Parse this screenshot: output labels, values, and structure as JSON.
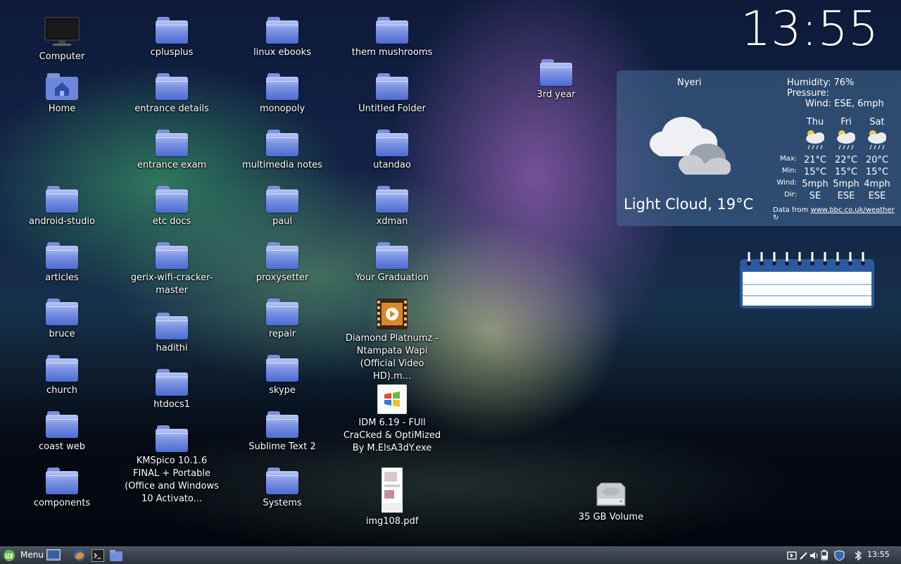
{
  "desktop_icons": [
    {
      "label": "Computer",
      "type": "computer"
    },
    {
      "label": "cplusplus",
      "type": "folder"
    },
    {
      "label": "linux ebooks",
      "type": "folder"
    },
    {
      "label": "them mushrooms",
      "type": "folder"
    },
    {
      "label": "Home",
      "type": "home"
    },
    {
      "label": "entrance details",
      "type": "folder"
    },
    {
      "label": "monopoly",
      "type": "folder"
    },
    {
      "label": "Untitled Folder",
      "type": "folder"
    },
    {
      "label": "3rd year",
      "type": "folder"
    },
    {
      "label": "entrance exam",
      "type": "folder"
    },
    {
      "label": "multimedia notes",
      "type": "folder"
    },
    {
      "label": "utandao",
      "type": "folder"
    },
    {
      "label": "android-studio",
      "type": "folder"
    },
    {
      "label": "etc docs",
      "type": "folder"
    },
    {
      "label": "paul",
      "type": "folder"
    },
    {
      "label": "xdman",
      "type": "folder"
    },
    {
      "label": "articles",
      "type": "folder"
    },
    {
      "label": "gerix-wifi-cracker-master",
      "type": "folder"
    },
    {
      "label": "proxysetter",
      "type": "folder"
    },
    {
      "label": "Your Graduation",
      "type": "folder"
    },
    {
      "label": "bruce",
      "type": "folder"
    },
    {
      "label": "repair",
      "type": "folder"
    },
    {
      "label": "Diamond Platnumz - Ntampata Wapi (Official Video HD).m...",
      "type": "video"
    },
    {
      "label": "hadithi",
      "type": "folder"
    },
    {
      "label": "church",
      "type": "folder"
    },
    {
      "label": "htdocs1",
      "type": "folder"
    },
    {
      "label": "skype",
      "type": "folder"
    },
    {
      "label": "IDM 6.19 - FUll CraCked & OptiMized By M.ElsA3dY.exe",
      "type": "exe"
    },
    {
      "label": "coast web",
      "type": "folder"
    },
    {
      "label": "KMSpico 10.1.6 FINAL + Portable (Office and Windows 10 Activato...",
      "type": "folder"
    },
    {
      "label": "Sublime Text 2",
      "type": "folder"
    },
    {
      "label": "components",
      "type": "folder"
    },
    {
      "label": "Systems",
      "type": "folder"
    },
    {
      "label": "img108.pdf",
      "type": "pdf"
    },
    {
      "label": "35 GB Volume",
      "type": "drive"
    }
  ],
  "clock": {
    "time": "13:55"
  },
  "weather": {
    "city": "Nyeri",
    "condition": "Light Cloud, 19°C",
    "humidity": "Humidity: 76%",
    "pressure": "Pressure:",
    "wind": "Wind: ESE, 6mph",
    "row_labels": [
      "Max:",
      "Min:",
      "Wind:",
      "Dir:"
    ],
    "forecast": [
      {
        "day": "Thu",
        "max": "21°C",
        "min": "15°C",
        "wind": "5mph",
        "dir": "SE"
      },
      {
        "day": "Fri",
        "max": "22°C",
        "min": "15°C",
        "wind": "5mph",
        "dir": "ESE"
      },
      {
        "day": "Sat",
        "max": "20°C",
        "min": "15°C",
        "wind": "4mph",
        "dir": "ESE"
      }
    ],
    "credit_prefix": "Data from ",
    "credit_link": "www.bbc.co.uk/weather"
  },
  "panel": {
    "menu_label": "Menu",
    "time": "13:55",
    "launchers": [
      "show-desktop-icon",
      "firefox-icon",
      "terminal-icon",
      "files-icon"
    ],
    "tray": [
      "media-icon",
      "pen-icon",
      "volume-icon",
      "battery-icon",
      "network-icon",
      "shield-icon",
      "bluetooth-icon"
    ]
  }
}
